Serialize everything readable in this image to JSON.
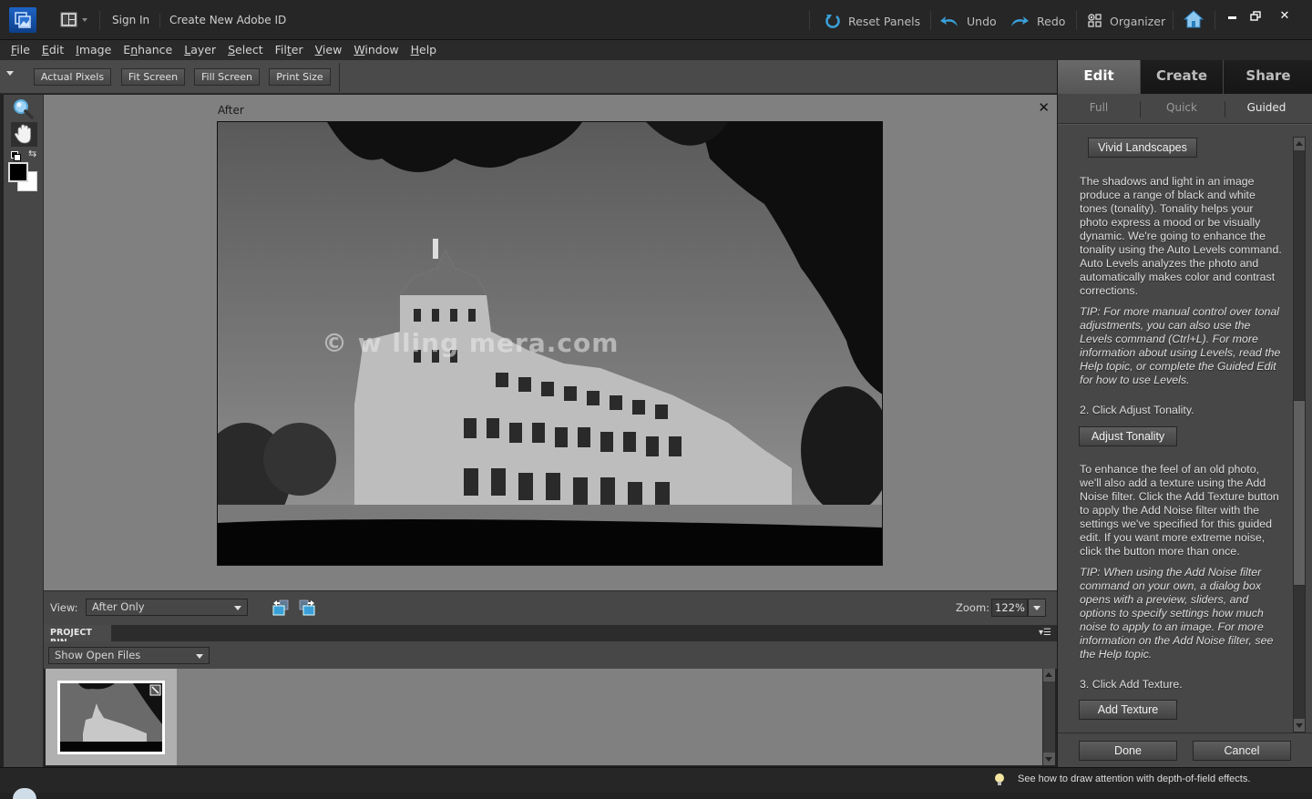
{
  "titlebar": {
    "sign_in": "Sign In",
    "create_id": "Create New Adobe ID",
    "reset_panels": "Reset Panels",
    "undo": "Undo",
    "redo": "Redo",
    "organizer": "Organizer"
  },
  "menu": [
    {
      "label": "File",
      "mnemonic": "F",
      "rest": "ile"
    },
    {
      "label": "Edit",
      "mnemonic": "E",
      "rest": "dit"
    },
    {
      "label": "Image",
      "mnemonic": "I",
      "rest": "mage"
    },
    {
      "label": "Enhance",
      "pre": "E",
      "mnemonic": "n",
      "rest": "hance"
    },
    {
      "label": "Layer",
      "mnemonic": "L",
      "rest": "ayer"
    },
    {
      "label": "Select",
      "mnemonic": "S",
      "rest": "elect"
    },
    {
      "label": "Filter",
      "pre": "Fil",
      "mnemonic": "t",
      "rest": "er"
    },
    {
      "label": "View",
      "mnemonic": "V",
      "rest": "iew"
    },
    {
      "label": "Window",
      "mnemonic": "W",
      "rest": "indow"
    },
    {
      "label": "Help",
      "mnemonic": "H",
      "rest": "elp"
    }
  ],
  "options": {
    "actual_pixels": "Actual Pixels",
    "fit_screen": "Fit Screen",
    "fill_screen": "Fill Screen",
    "print_size": "Print Size"
  },
  "canvas": {
    "label": "After",
    "watermark": "© w                lling   mera.com"
  },
  "viewbar": {
    "view_label": "View:",
    "view_value": "After Only",
    "zoom_label": "Zoom:",
    "zoom_value": "122%"
  },
  "bin": {
    "tab": "PROJECT BIN",
    "filter_value": "Show Open Files"
  },
  "panel": {
    "tabs": [
      {
        "label": "Edit",
        "active": true
      },
      {
        "label": "Create",
        "active": false
      },
      {
        "label": "Share",
        "active": false
      }
    ],
    "subtabs": [
      {
        "label": "Full",
        "active": false
      },
      {
        "label": "Quick",
        "active": false
      },
      {
        "label": "Guided",
        "active": true
      }
    ],
    "guide": {
      "title_button": "Vivid Landscapes",
      "intro": "The shadows and light in an image produce a range of black and white tones (tonality). Tonality helps your photo express a mood or be visually dynamic. We're going to enhance the tonality using the Auto Levels command. Auto Levels analyzes the photo and automatically makes color and contrast corrections.",
      "tip1": "TIP: For more manual control over tonal adjustments, you can also use the Levels command (Ctrl+L). For more information about using Levels, read the Help topic, or complete the Guided Edit for how to use Levels.",
      "step2": "2. Click Adjust Tonality.",
      "step2_button": "Adjust Tonality",
      "texture_text": "To enhance the feel of an old photo, we'll also add a texture using the Add Noise filter. Click the Add Texture button to apply the Add Noise filter with the settings we've specified for this guided edit. If you want more extreme noise, click the button more than once.",
      "tip2": "TIP: When using the Add Noise filter command on your own, a dialog box opens with a preview, sliders, and options to specify settings how much noise to apply to an image. For more information on the Add Noise filter, see the Help topic.",
      "step3": "3. Click Add Texture.",
      "step3_button": "Add Texture"
    },
    "done": "Done",
    "cancel": "Cancel"
  },
  "status": {
    "tip": "See how to draw attention with depth-of-field effects."
  },
  "colors": {
    "accent_blue": "#3a9fd8",
    "logo_blue": "#1d64c4",
    "canvas_bg": "#808080",
    "panel_bg": "#474747"
  }
}
